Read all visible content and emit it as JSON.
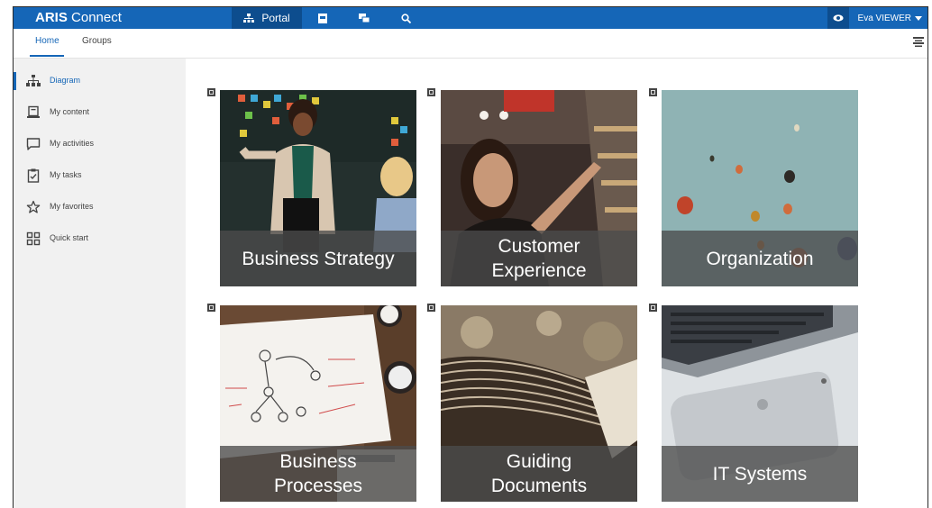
{
  "app": {
    "brand_bold": "ARIS",
    "brand_rest": "Connect"
  },
  "topnav": {
    "portal_label": "Portal"
  },
  "user": {
    "name": "Eva VIEWER"
  },
  "tabs": [
    {
      "label": "Home"
    },
    {
      "label": "Groups"
    }
  ],
  "sidebar": {
    "items": [
      {
        "label": "Diagram",
        "icon": "diagram-icon"
      },
      {
        "label": "My content",
        "icon": "content-icon"
      },
      {
        "label": "My activities",
        "icon": "activities-icon"
      },
      {
        "label": "My tasks",
        "icon": "tasks-icon"
      },
      {
        "label": "My favorites",
        "icon": "star-icon"
      },
      {
        "label": "Quick start",
        "icon": "grid-icon"
      }
    ]
  },
  "tiles": [
    {
      "label": "Business Strategy"
    },
    {
      "label": "Customer\nExperience"
    },
    {
      "label": "Organization"
    },
    {
      "label": "Business\nProcesses"
    },
    {
      "label": "Guiding\nDocuments"
    },
    {
      "label": "IT Systems"
    }
  ],
  "colors": {
    "accent": "#1566b7",
    "accent_dark": "#0d4d8e",
    "sidebar_bg": "#f1f1f1"
  }
}
